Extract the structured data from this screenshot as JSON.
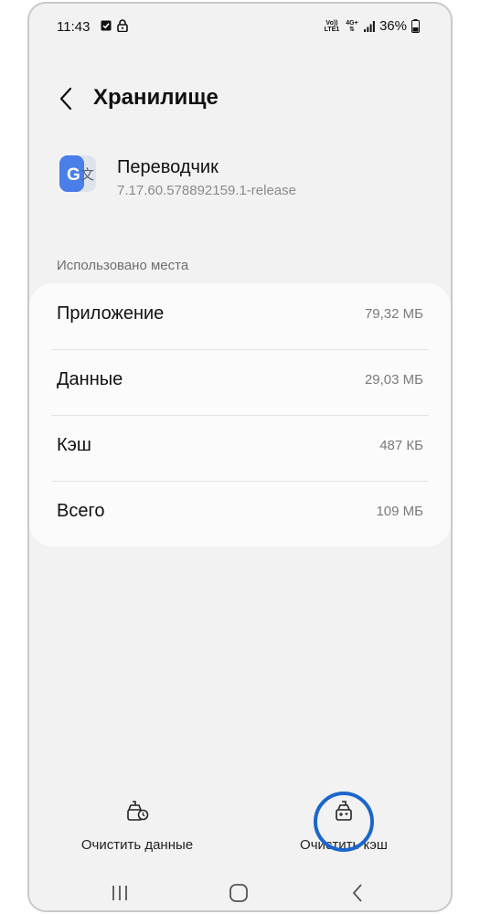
{
  "status_bar": {
    "time": "11:43",
    "net_volte": "Vo)) LTE1",
    "net_4g": "4G+",
    "battery": "36%",
    "icons": [
      "checkbox-icon",
      "lock-icon",
      "volte-icon",
      "4g-icon",
      "signal-icon",
      "battery-icon"
    ]
  },
  "header": {
    "back_icon": "back-chevron-icon",
    "title": "Хранилище"
  },
  "app": {
    "icon": "google-translate-icon",
    "name": "Переводчик",
    "version": "7.17.60.578892159.1-release"
  },
  "storage": {
    "section_label": "Использовано места",
    "rows": [
      {
        "label": "Приложение",
        "value": "79,32 МБ"
      },
      {
        "label": "Данные",
        "value": "29,03 МБ"
      },
      {
        "label": "Кэш",
        "value": "487 КБ"
      },
      {
        "label": "Всего",
        "value": "109 МБ"
      }
    ]
  },
  "actions": {
    "clear_data": {
      "label": "Очистить данные",
      "icon": "clear-data-icon"
    },
    "clear_cache": {
      "label": "Очистить кэш",
      "icon": "clear-cache-icon"
    }
  },
  "nav": {
    "icons": [
      "recents-icon",
      "home-icon",
      "back-icon"
    ]
  },
  "colors": {
    "background": "#f2f2f2",
    "card": "#fbfbfb",
    "highlight": "#1a66cc",
    "google_blue": "#4a7ee8"
  }
}
